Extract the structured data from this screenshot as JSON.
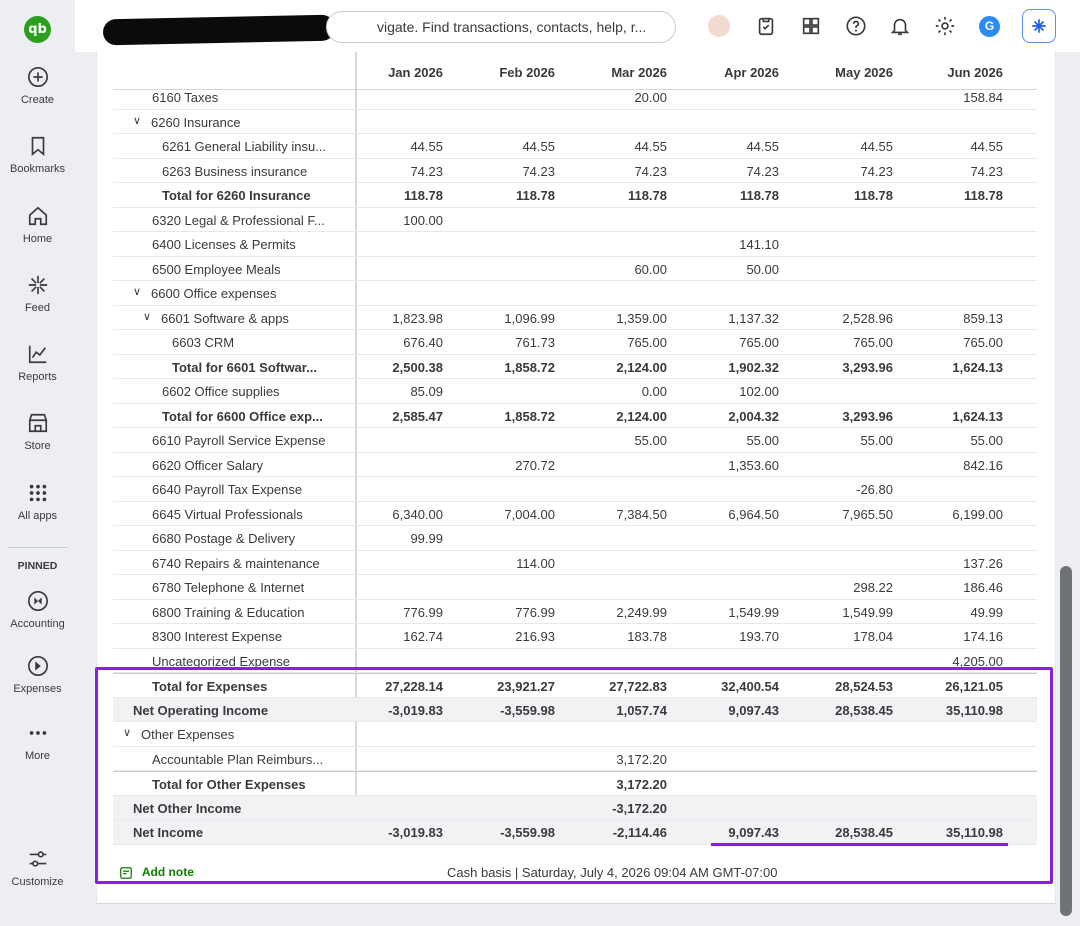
{
  "app": {
    "logo_text": "qb"
  },
  "nav": {
    "items": [
      {
        "label": "Create",
        "icon": "plus-circle-icon"
      },
      {
        "label": "Bookmarks",
        "icon": "bookmark-icon"
      },
      {
        "label": "Home",
        "icon": "home-icon"
      },
      {
        "label": "Feed",
        "icon": "sparkle-icon"
      },
      {
        "label": "Reports",
        "icon": "chart-icon"
      },
      {
        "label": "Store",
        "icon": "store-icon"
      },
      {
        "label": "All apps",
        "icon": "grid-icon"
      }
    ],
    "pinned_label": "PINNED",
    "pinned": [
      {
        "label": "Accounting",
        "icon": "accounting-icon"
      },
      {
        "label": "Expenses",
        "icon": "expenses-icon"
      },
      {
        "label": "More",
        "icon": "more-icon"
      }
    ],
    "customize_label": "Customize"
  },
  "topbar": {
    "search_text": "vigate. Find transactions, contacts, help, r...",
    "user_initial": "G"
  },
  "report": {
    "months": [
      "Jan 2026",
      "Feb 2026",
      "Mar 2026",
      "Apr 2026",
      "May 2026",
      "Jun 2026"
    ],
    "rows": [
      {
        "label": "6160 Taxes",
        "indent": 2,
        "values": [
          "",
          "",
          "20.00",
          "",
          "",
          "158.84"
        ]
      },
      {
        "label": "6260 Insurance",
        "indent": 1,
        "chevron": true,
        "values": [
          "",
          "",
          "",
          "",
          "",
          ""
        ]
      },
      {
        "label": "6261 General Liability insu...",
        "indent": 3,
        "values": [
          "44.55",
          "44.55",
          "44.55",
          "44.55",
          "44.55",
          "44.55"
        ]
      },
      {
        "label": "6263 Business insurance",
        "indent": 3,
        "values": [
          "74.23",
          "74.23",
          "74.23",
          "74.23",
          "74.23",
          "74.23"
        ]
      },
      {
        "label": "Total for 6260 Insurance",
        "indent": 3,
        "bold": true,
        "values": [
          "118.78",
          "118.78",
          "118.78",
          "118.78",
          "118.78",
          "118.78"
        ]
      },
      {
        "label": "6320 Legal & Professional F...",
        "indent": 2,
        "values": [
          "100.00",
          "",
          "",
          "",
          "",
          ""
        ]
      },
      {
        "label": "6400 Licenses & Permits",
        "indent": 2,
        "values": [
          "",
          "",
          "",
          "141.10",
          "",
          ""
        ]
      },
      {
        "label": "6500 Employee Meals",
        "indent": 2,
        "values": [
          "",
          "",
          "60.00",
          "50.00",
          "",
          ""
        ]
      },
      {
        "label": "6600 Office expenses",
        "indent": 1,
        "chevron": true,
        "values": [
          "",
          "",
          "",
          "",
          "",
          ""
        ]
      },
      {
        "label": "6601 Software & apps",
        "indent": 2,
        "chevron": true,
        "values": [
          "1,823.98",
          "1,096.99",
          "1,359.00",
          "1,137.32",
          "2,528.96",
          "859.13"
        ]
      },
      {
        "label": "6603 CRM",
        "indent": 4,
        "values": [
          "676.40",
          "761.73",
          "765.00",
          "765.00",
          "765.00",
          "765.00"
        ]
      },
      {
        "label": "Total for 6601 Softwar...",
        "indent": 4,
        "bold": true,
        "values": [
          "2,500.38",
          "1,858.72",
          "2,124.00",
          "1,902.32",
          "3,293.96",
          "1,624.13"
        ]
      },
      {
        "label": "6602 Office supplies",
        "indent": 3,
        "values": [
          "85.09",
          "",
          "0.00",
          "102.00",
          "",
          ""
        ]
      },
      {
        "label": "Total for 6600 Office exp...",
        "indent": 3,
        "bold": true,
        "values": [
          "2,585.47",
          "1,858.72",
          "2,124.00",
          "2,004.32",
          "3,293.96",
          "1,624.13"
        ]
      },
      {
        "label": "6610 Payroll Service Expense",
        "indent": 2,
        "values": [
          "",
          "",
          "55.00",
          "55.00",
          "55.00",
          "55.00"
        ]
      },
      {
        "label": "6620 Officer Salary",
        "indent": 2,
        "values": [
          "",
          "270.72",
          "",
          "1,353.60",
          "",
          "842.16"
        ]
      },
      {
        "label": "6640 Payroll Tax Expense",
        "indent": 2,
        "values": [
          "",
          "",
          "",
          "",
          "-26.80",
          ""
        ]
      },
      {
        "label": "6645 Virtual Professionals",
        "indent": 2,
        "values": [
          "6,340.00",
          "7,004.00",
          "7,384.50",
          "6,964.50",
          "7,965.50",
          "6,199.00"
        ]
      },
      {
        "label": "6680 Postage & Delivery",
        "indent": 2,
        "values": [
          "99.99",
          "",
          "",
          "",
          "",
          ""
        ]
      },
      {
        "label": "6740 Repairs & maintenance",
        "indent": 2,
        "values": [
          "",
          "114.00",
          "",
          "",
          "",
          "137.26"
        ]
      },
      {
        "label": "6780 Telephone & Internet",
        "indent": 2,
        "values": [
          "",
          "",
          "",
          "",
          "298.22",
          "186.46"
        ]
      },
      {
        "label": "6800 Training & Education",
        "indent": 2,
        "values": [
          "776.99",
          "776.99",
          "2,249.99",
          "1,549.99",
          "1,549.99",
          "49.99"
        ]
      },
      {
        "label": "8300 Interest Expense",
        "indent": 2,
        "values": [
          "162.74",
          "216.93",
          "183.78",
          "193.70",
          "178.04",
          "174.16"
        ]
      },
      {
        "label": "Uncategorized Expense",
        "indent": 2,
        "values": [
          "",
          "",
          "",
          "",
          "",
          "4,205.00"
        ]
      },
      {
        "label": "Total for Expenses",
        "indent": 2,
        "bold": true,
        "topline": true,
        "values": [
          "27,228.14",
          "23,921.27",
          "27,722.83",
          "32,400.54",
          "28,524.53",
          "26,121.05"
        ]
      },
      {
        "label": "Net Operating Income",
        "indent": 1,
        "bold": true,
        "shaded": true,
        "values": [
          "-3,019.83",
          "-3,559.98",
          "1,057.74",
          "9,097.43",
          "28,538.45",
          "35,110.98"
        ]
      },
      {
        "label": "Other Expenses",
        "indent": 0,
        "chevron": true,
        "values": [
          "",
          "",
          "",
          "",
          "",
          ""
        ]
      },
      {
        "label": "Accountable Plan Reimburs...",
        "indent": 2,
        "values": [
          "",
          "",
          "3,172.20",
          "",
          "",
          ""
        ]
      },
      {
        "label": "Total for Other Expenses",
        "indent": 2,
        "bold": true,
        "topline": true,
        "values": [
          "",
          "",
          "3,172.20",
          "",
          "",
          ""
        ]
      },
      {
        "label": "Net Other Income",
        "indent": 1,
        "bold": true,
        "shaded": true,
        "values": [
          "",
          "",
          "-3,172.20",
          "",
          "",
          ""
        ]
      },
      {
        "label": "Net Income",
        "indent": 1,
        "bold": true,
        "shaded": true,
        "values": [
          "-3,019.83",
          "-3,559.98",
          "-2,114.46",
          "9,097.43",
          "28,538.45",
          "35,110.98"
        ]
      }
    ],
    "footer": {
      "add_note_label": "Add note",
      "info": "Cash basis  |  Saturday, July 4, 2026 09:04 AM GMT-07:00"
    }
  },
  "colors": {
    "brand": "#2ca01c",
    "highlight": "#8a1ee8",
    "accent_link": "#108000"
  }
}
